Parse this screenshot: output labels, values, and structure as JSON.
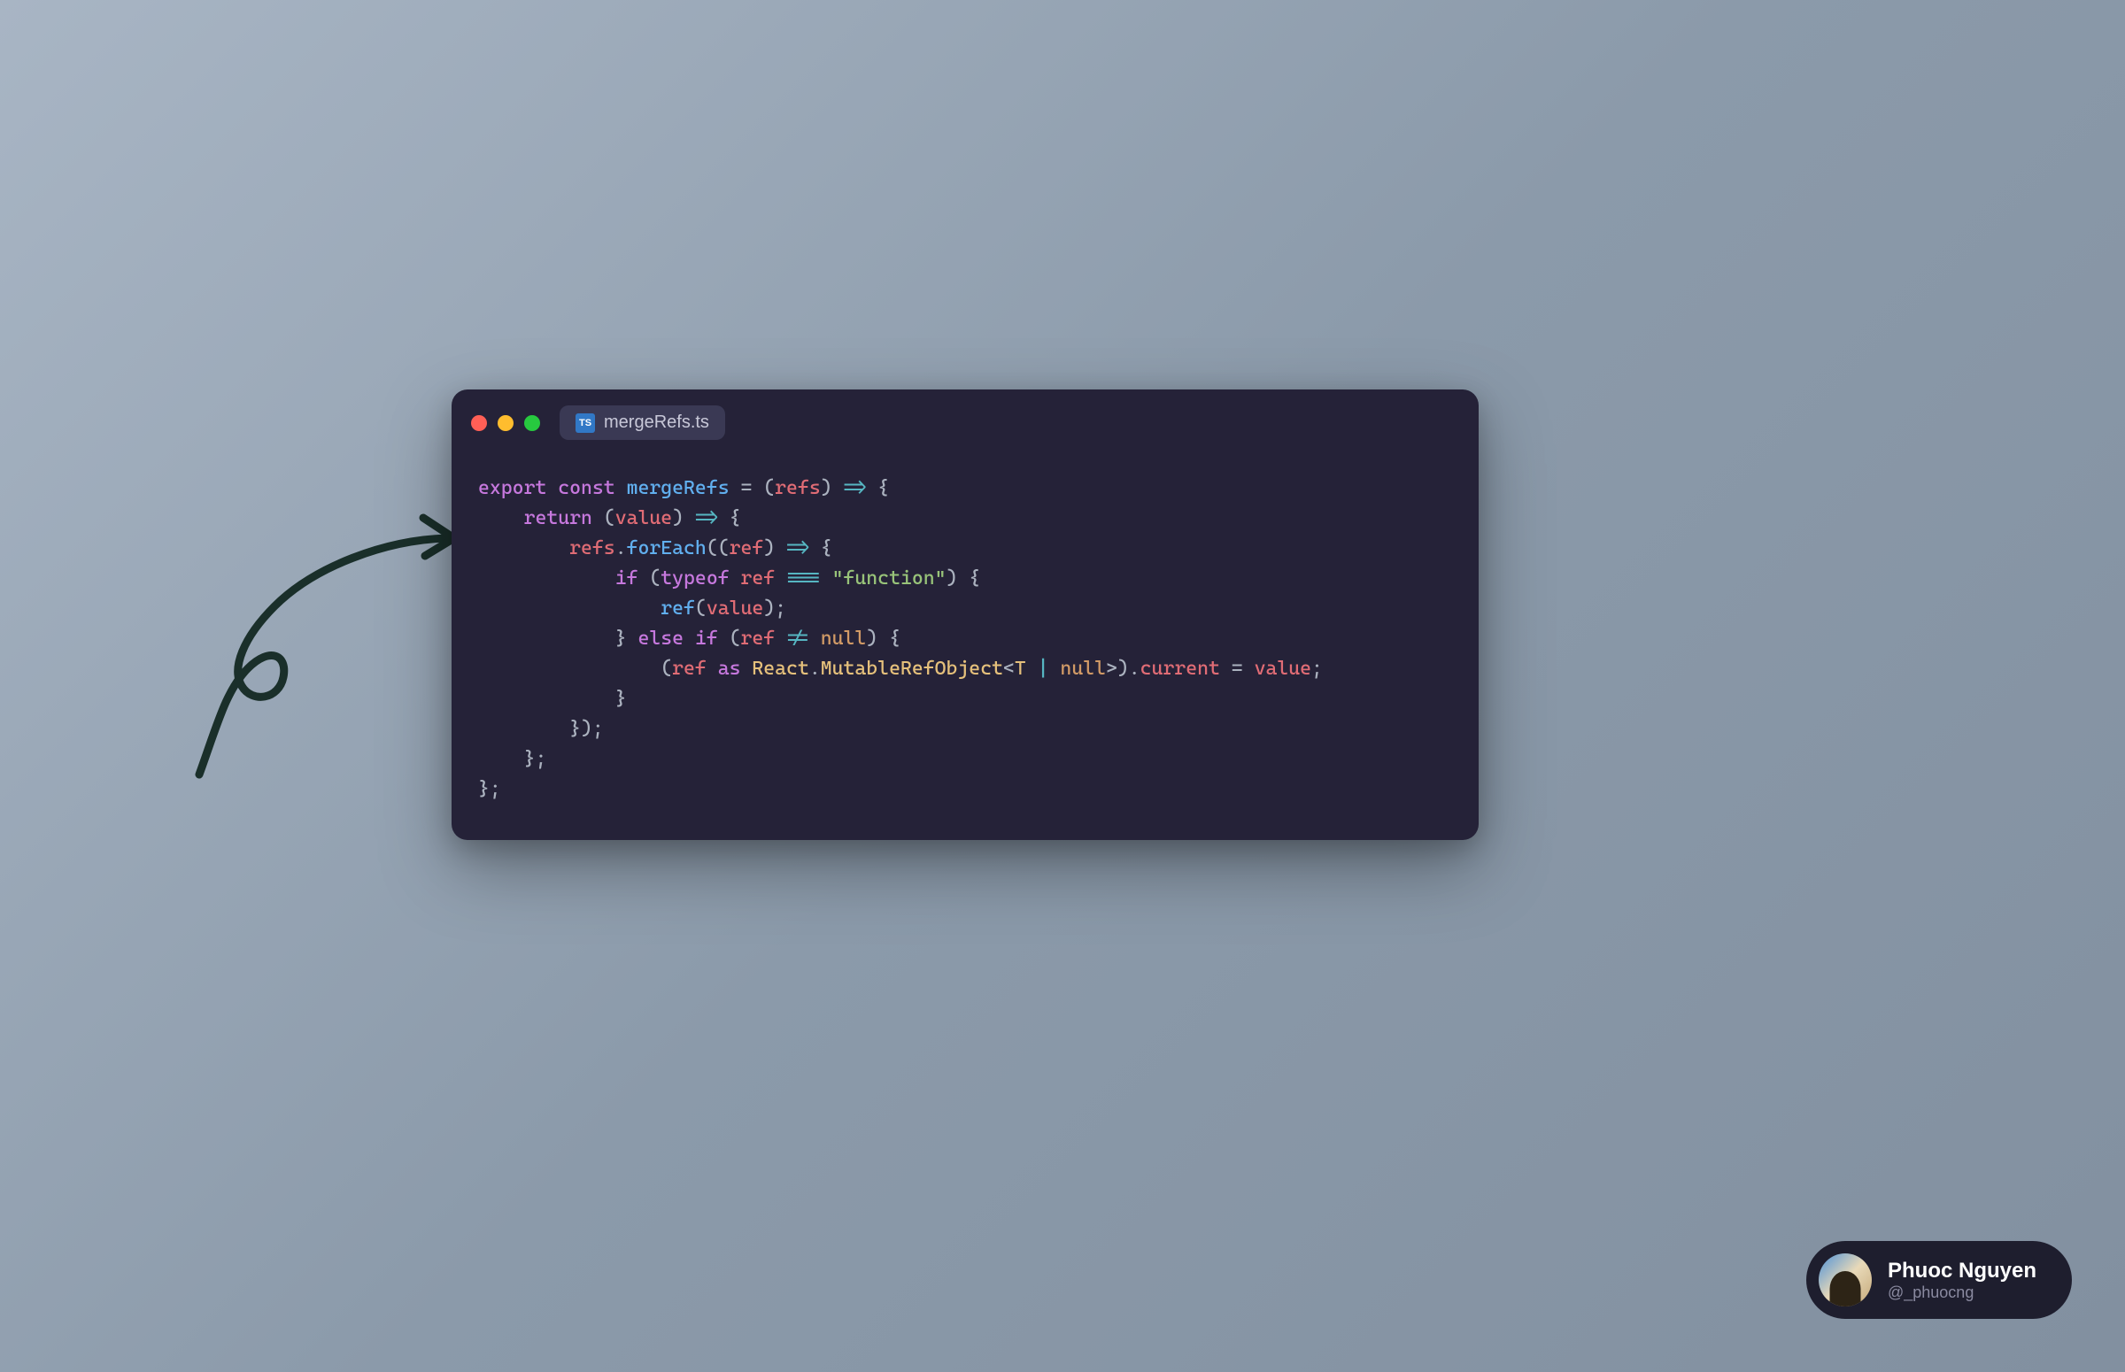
{
  "window": {
    "file_icon_text": "TS",
    "file_name": "mergeRefs.ts"
  },
  "code": {
    "l1_export": "export",
    "l1_const": "const",
    "l1_fn": "mergeRefs",
    "l1_eq": " = ",
    "l1_lp": "(",
    "l1_param": "refs",
    "l1_rp": ")",
    "l1_arrow": " => ",
    "l1_lb": "{",
    "l2_indent": "    ",
    "l2_return": "return",
    "l2_lp": " (",
    "l2_param": "value",
    "l2_rp": ")",
    "l2_arrow": " => ",
    "l2_lb": "{",
    "l3_indent": "        ",
    "l3_refs": "refs",
    "l3_dot": ".",
    "l3_foreach": "forEach",
    "l3_lp": "((",
    "l3_param": "ref",
    "l3_rp": ")",
    "l3_arrow": " => ",
    "l3_lb": "{",
    "l4_indent": "            ",
    "l4_if": "if",
    "l4_lp": " (",
    "l4_typeof": "typeof",
    "l4_sp": " ",
    "l4_ref": "ref",
    "l4_eqeq": " === ",
    "l4_str": "\"function\"",
    "l4_rp": ")",
    "l4_lb": " {",
    "l5_indent": "                ",
    "l5_ref": "ref",
    "l5_lp": "(",
    "l5_value": "value",
    "l5_rp": ");",
    "l6_indent": "            ",
    "l6_rb": "}",
    "l6_else": " else if",
    "l6_lp": " (",
    "l6_ref": "ref",
    "l6_neq": " != ",
    "l6_null": "null",
    "l6_rp": ")",
    "l6_lb": " {",
    "l7_indent": "                ",
    "l7_lp": "(",
    "l7_ref": "ref",
    "l7_as": " as ",
    "l7_react": "React",
    "l7_dot": ".",
    "l7_mro": "MutableRefObject",
    "l7_lt": "<",
    "l7_t": "T",
    "l7_pipe": " | ",
    "l7_null": "null",
    "l7_gt": ">",
    "l7_rp": ").",
    "l7_current": "current",
    "l7_eq": " = ",
    "l7_value": "value",
    "l7_semi": ";",
    "l8_indent": "            ",
    "l8_rb": "}",
    "l9_indent": "        ",
    "l9_rb": "});",
    "l10_indent": "    ",
    "l10_rb": "};",
    "l11_rb": "};"
  },
  "author": {
    "name": "Phuoc Nguyen",
    "handle": "@_phuocng"
  }
}
